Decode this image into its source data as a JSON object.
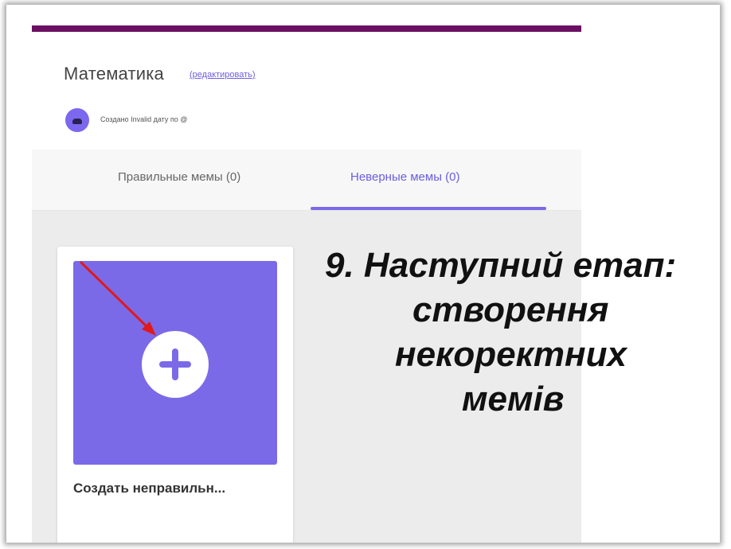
{
  "header": {
    "title": "Математика",
    "edit_link": "(редактировать)",
    "created_text": "Создано Invalid дату по @"
  },
  "tabs": [
    {
      "label": "Правильные мемы (0)",
      "active": false
    },
    {
      "label": "Неверные мемы (0)",
      "active": true
    }
  ],
  "card": {
    "label": "Создать неправильн..."
  },
  "annotation": {
    "lines": [
      "9. Наступний етап:",
      "створення",
      "некоректних",
      "мемів"
    ]
  },
  "colors": {
    "accent": "#7b6ae8",
    "topbar": "#6b0f63",
    "arrow": "#e0191b"
  },
  "icons": {
    "create_icon": "plus-icon",
    "avatar_icon": "avatar-icon",
    "arrow_icon": "red-arrow-icon"
  }
}
